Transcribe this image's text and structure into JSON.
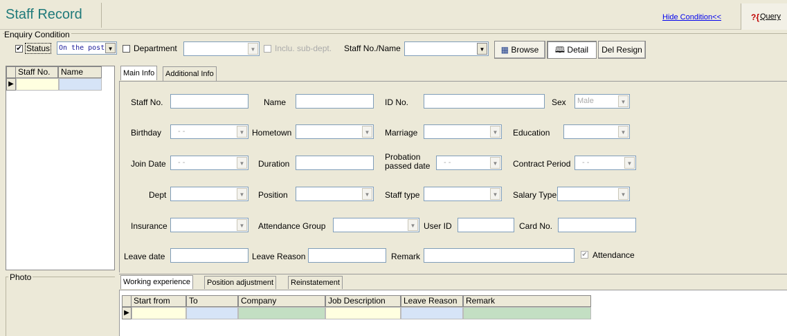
{
  "header": {
    "title": "Staff Record",
    "hide_condition": "Hide Condition<<",
    "query_q": "?{",
    "query_label": "Query"
  },
  "enquiry": {
    "section_label": "Enquiry Condition",
    "status_label": "Status",
    "status_value": "On the post",
    "department_label": "Department",
    "inclu_subdept_label": "Inclu. sub-dept.",
    "staff_no_name_label": "Staff No./Name",
    "browse_label": "Browse",
    "detail_label": "Detail",
    "del_resign_label": "Del Resign"
  },
  "staff_grid": {
    "columns": [
      "Staff No.",
      "Name"
    ]
  },
  "tabs": [
    "Main Info",
    "Additional Info"
  ],
  "form": {
    "staff_no": "Staff No.",
    "name": "Name",
    "id_no": "ID No.",
    "sex": "Sex",
    "sex_value": "Male",
    "birthday": "Birthday",
    "birthday_value": "- -",
    "hometown": "Hometown",
    "marriage": "Marriage",
    "education": "Education",
    "join_date": "Join Date",
    "join_date_value": "- -",
    "duration": "Duration",
    "probation_1": "Probation",
    "probation_2": "passed date",
    "probation_value": "- -",
    "contract_period": "Contract Period",
    "contract_value": "- -",
    "dept": "Dept",
    "position": "Position",
    "staff_type": "Staff type",
    "salary_type": "Salary Type",
    "insurance": "Insurance",
    "attendance_group": "Attendance Group",
    "user_id": "User ID",
    "card_no": "Card No.",
    "leave_date": "Leave date",
    "leave_reason": "Leave Reason",
    "remark": "Remark",
    "attendance": "Attendance"
  },
  "photo_label": "Photo",
  "bottom_tabs": [
    "Working experience",
    "Position adjustment",
    "Reinstatement"
  ],
  "work_grid": {
    "columns": [
      "Start from",
      "To",
      "Company",
      "Job Description",
      "Leave Reason",
      "Remark"
    ]
  }
}
